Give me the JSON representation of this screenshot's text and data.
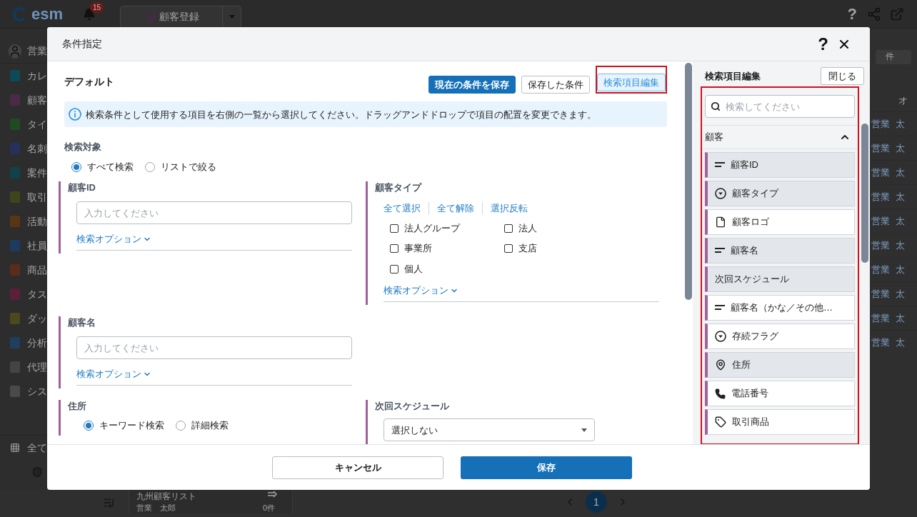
{
  "app": {
    "logo": "esm",
    "notification_count": "15",
    "tab": {
      "label": "顧客登録"
    },
    "help_glyph": "?"
  },
  "sidebar": {
    "user": "営業",
    "items": [
      {
        "label": "カレ",
        "color": "#0d4a57"
      },
      {
        "label": "顧客",
        "color": "#4a2a47"
      },
      {
        "label": "タイ",
        "color": "#1f4b22"
      },
      {
        "label": "名刺",
        "color": "#26305c"
      },
      {
        "label": "案件",
        "color": "#0f4249"
      },
      {
        "label": "取引",
        "color": "#3f4519"
      },
      {
        "label": "活動",
        "color": "#5a3511"
      },
      {
        "label": "社員",
        "color": "#1d3b5f"
      },
      {
        "label": "商品",
        "color": "#5b2c1b"
      },
      {
        "label": "タス",
        "color": "#5b2037"
      },
      {
        "label": "ダッ",
        "color": "#4a4a1c"
      },
      {
        "label": "分析",
        "color": "#1f3f5c"
      },
      {
        "label": "代理",
        "color": "#444444"
      },
      {
        "label": "シス",
        "color": "#4a4a4a"
      }
    ],
    "all_label": "全て"
  },
  "right_strip": {
    "button": "件",
    "column_header": "オ",
    "rows": [
      {
        "cell_1": "営業",
        "cell_2": "太"
      },
      {
        "cell_1": "営業",
        "cell_2": "太"
      },
      {
        "cell_1": "営業",
        "cell_2": "太"
      },
      {
        "cell_1": "営業",
        "cell_2": "太"
      },
      {
        "cell_1": "営業",
        "cell_2": "太"
      },
      {
        "cell_1": "営業",
        "cell_2": "太"
      },
      {
        "cell_1": "営業",
        "cell_2": "太"
      },
      {
        "cell_1": "営業",
        "cell_2": "太"
      },
      {
        "cell_1": "営業",
        "cell_2": "太"
      },
      {
        "cell_1": "営業",
        "cell_2": "太"
      }
    ]
  },
  "bottom": {
    "list_name": "九州顧客リスト",
    "owner": "営業　太郎",
    "count": "0件",
    "page": "1"
  },
  "dialog": {
    "title": "条件指定",
    "help_glyph": "?",
    "preset": "デフォルト",
    "buttons": [
      {
        "label": "現在の条件を保存",
        "kind": "primary",
        "highlighted": false
      },
      {
        "label": "保存した条件",
        "kind": "outline",
        "highlighted": false
      },
      {
        "label": "検索項目編集",
        "kind": "active",
        "highlighted": true
      }
    ],
    "info": "検索条件として使用する項目を右側の一覧から選択してください。ドラッグアンドドロップで項目の配置を変更できます。",
    "scope": {
      "label": "検索対象",
      "options": [
        {
          "label": "すべて検索",
          "selected": true
        },
        {
          "label": "リストで絞る",
          "selected": false
        }
      ]
    },
    "rows": [
      {
        "left": {
          "kind": "text",
          "label": "顧客ID",
          "placeholder": "入力してください",
          "option_link": "検索オプション"
        },
        "right": {
          "kind": "checklist",
          "label": "顧客タイプ",
          "actions": [
            "全て選択",
            "全て解除",
            "選択反転"
          ],
          "options": [
            {
              "label": "法人グループ",
              "checked": false
            },
            {
              "label": "法人",
              "checked": false
            },
            {
              "label": "事業所",
              "checked": false
            },
            {
              "label": "支店",
              "checked": false
            },
            {
              "label": "個人",
              "checked": false
            }
          ],
          "option_link": "検索オプション"
        }
      },
      {
        "left": {
          "kind": "text",
          "label": "顧客名",
          "placeholder": "入力してください",
          "option_link": "検索オプション"
        }
      },
      {
        "left": {
          "kind": "radio",
          "label": "住所",
          "options": [
            {
              "label": "キーワード検索",
              "selected": true
            },
            {
              "label": "詳細検索",
              "selected": false
            }
          ]
        },
        "right": {
          "kind": "select",
          "label": "次回スケジュール",
          "value": "選択しない"
        }
      }
    ],
    "cancel": "キャンセル",
    "save": "保存",
    "panel": {
      "title": "検索項目編集",
      "close": "閉じる",
      "highlighted": true,
      "search_placeholder": "検索してください",
      "group": {
        "label": "顧客",
        "expanded": true
      },
      "items": [
        {
          "label": "顧客ID",
          "kind": "text",
          "selected": true
        },
        {
          "label": "顧客タイプ",
          "kind": "select",
          "selected": true
        },
        {
          "label": "顧客ロゴ",
          "kind": "file",
          "selected": false
        },
        {
          "label": "顧客名",
          "kind": "text",
          "selected": true
        },
        {
          "label": "次回スケジュール",
          "kind": "plain",
          "selected": true
        },
        {
          "label": "顧客名（かな／その他…",
          "kind": "text",
          "selected": false
        },
        {
          "label": "存続フラグ",
          "kind": "select",
          "selected": false
        },
        {
          "label": "住所",
          "kind": "location",
          "selected": true
        },
        {
          "label": "電話番号",
          "kind": "phone",
          "selected": false
        },
        {
          "label": "取引商品",
          "kind": "product",
          "selected": false
        }
      ]
    }
  }
}
